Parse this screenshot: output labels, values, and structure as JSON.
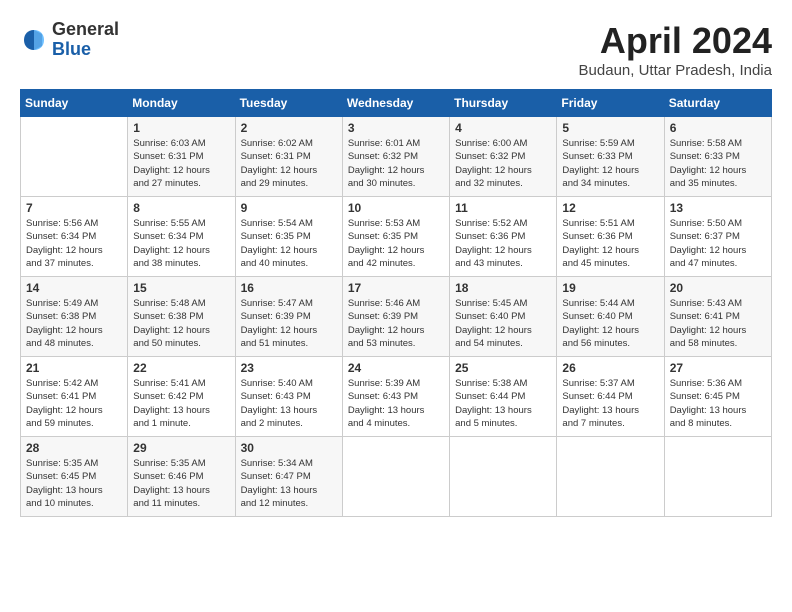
{
  "header": {
    "logo_general": "General",
    "logo_blue": "Blue",
    "month_title": "April 2024",
    "location": "Budaun, Uttar Pradesh, India"
  },
  "days_of_week": [
    "Sunday",
    "Monday",
    "Tuesday",
    "Wednesday",
    "Thursday",
    "Friday",
    "Saturday"
  ],
  "weeks": [
    [
      {
        "num": "",
        "data": ""
      },
      {
        "num": "1",
        "data": "Sunrise: 6:03 AM\nSunset: 6:31 PM\nDaylight: 12 hours\nand 27 minutes."
      },
      {
        "num": "2",
        "data": "Sunrise: 6:02 AM\nSunset: 6:31 PM\nDaylight: 12 hours\nand 29 minutes."
      },
      {
        "num": "3",
        "data": "Sunrise: 6:01 AM\nSunset: 6:32 PM\nDaylight: 12 hours\nand 30 minutes."
      },
      {
        "num": "4",
        "data": "Sunrise: 6:00 AM\nSunset: 6:32 PM\nDaylight: 12 hours\nand 32 minutes."
      },
      {
        "num": "5",
        "data": "Sunrise: 5:59 AM\nSunset: 6:33 PM\nDaylight: 12 hours\nand 34 minutes."
      },
      {
        "num": "6",
        "data": "Sunrise: 5:58 AM\nSunset: 6:33 PM\nDaylight: 12 hours\nand 35 minutes."
      }
    ],
    [
      {
        "num": "7",
        "data": "Sunrise: 5:56 AM\nSunset: 6:34 PM\nDaylight: 12 hours\nand 37 minutes."
      },
      {
        "num": "8",
        "data": "Sunrise: 5:55 AM\nSunset: 6:34 PM\nDaylight: 12 hours\nand 38 minutes."
      },
      {
        "num": "9",
        "data": "Sunrise: 5:54 AM\nSunset: 6:35 PM\nDaylight: 12 hours\nand 40 minutes."
      },
      {
        "num": "10",
        "data": "Sunrise: 5:53 AM\nSunset: 6:35 PM\nDaylight: 12 hours\nand 42 minutes."
      },
      {
        "num": "11",
        "data": "Sunrise: 5:52 AM\nSunset: 6:36 PM\nDaylight: 12 hours\nand 43 minutes."
      },
      {
        "num": "12",
        "data": "Sunrise: 5:51 AM\nSunset: 6:36 PM\nDaylight: 12 hours\nand 45 minutes."
      },
      {
        "num": "13",
        "data": "Sunrise: 5:50 AM\nSunset: 6:37 PM\nDaylight: 12 hours\nand 47 minutes."
      }
    ],
    [
      {
        "num": "14",
        "data": "Sunrise: 5:49 AM\nSunset: 6:38 PM\nDaylight: 12 hours\nand 48 minutes."
      },
      {
        "num": "15",
        "data": "Sunrise: 5:48 AM\nSunset: 6:38 PM\nDaylight: 12 hours\nand 50 minutes."
      },
      {
        "num": "16",
        "data": "Sunrise: 5:47 AM\nSunset: 6:39 PM\nDaylight: 12 hours\nand 51 minutes."
      },
      {
        "num": "17",
        "data": "Sunrise: 5:46 AM\nSunset: 6:39 PM\nDaylight: 12 hours\nand 53 minutes."
      },
      {
        "num": "18",
        "data": "Sunrise: 5:45 AM\nSunset: 6:40 PM\nDaylight: 12 hours\nand 54 minutes."
      },
      {
        "num": "19",
        "data": "Sunrise: 5:44 AM\nSunset: 6:40 PM\nDaylight: 12 hours\nand 56 minutes."
      },
      {
        "num": "20",
        "data": "Sunrise: 5:43 AM\nSunset: 6:41 PM\nDaylight: 12 hours\nand 58 minutes."
      }
    ],
    [
      {
        "num": "21",
        "data": "Sunrise: 5:42 AM\nSunset: 6:41 PM\nDaylight: 12 hours\nand 59 minutes."
      },
      {
        "num": "22",
        "data": "Sunrise: 5:41 AM\nSunset: 6:42 PM\nDaylight: 13 hours\nand 1 minute."
      },
      {
        "num": "23",
        "data": "Sunrise: 5:40 AM\nSunset: 6:43 PM\nDaylight: 13 hours\nand 2 minutes."
      },
      {
        "num": "24",
        "data": "Sunrise: 5:39 AM\nSunset: 6:43 PM\nDaylight: 13 hours\nand 4 minutes."
      },
      {
        "num": "25",
        "data": "Sunrise: 5:38 AM\nSunset: 6:44 PM\nDaylight: 13 hours\nand 5 minutes."
      },
      {
        "num": "26",
        "data": "Sunrise: 5:37 AM\nSunset: 6:44 PM\nDaylight: 13 hours\nand 7 minutes."
      },
      {
        "num": "27",
        "data": "Sunrise: 5:36 AM\nSunset: 6:45 PM\nDaylight: 13 hours\nand 8 minutes."
      }
    ],
    [
      {
        "num": "28",
        "data": "Sunrise: 5:35 AM\nSunset: 6:45 PM\nDaylight: 13 hours\nand 10 minutes."
      },
      {
        "num": "29",
        "data": "Sunrise: 5:35 AM\nSunset: 6:46 PM\nDaylight: 13 hours\nand 11 minutes."
      },
      {
        "num": "30",
        "data": "Sunrise: 5:34 AM\nSunset: 6:47 PM\nDaylight: 13 hours\nand 12 minutes."
      },
      {
        "num": "",
        "data": ""
      },
      {
        "num": "",
        "data": ""
      },
      {
        "num": "",
        "data": ""
      },
      {
        "num": "",
        "data": ""
      }
    ]
  ]
}
